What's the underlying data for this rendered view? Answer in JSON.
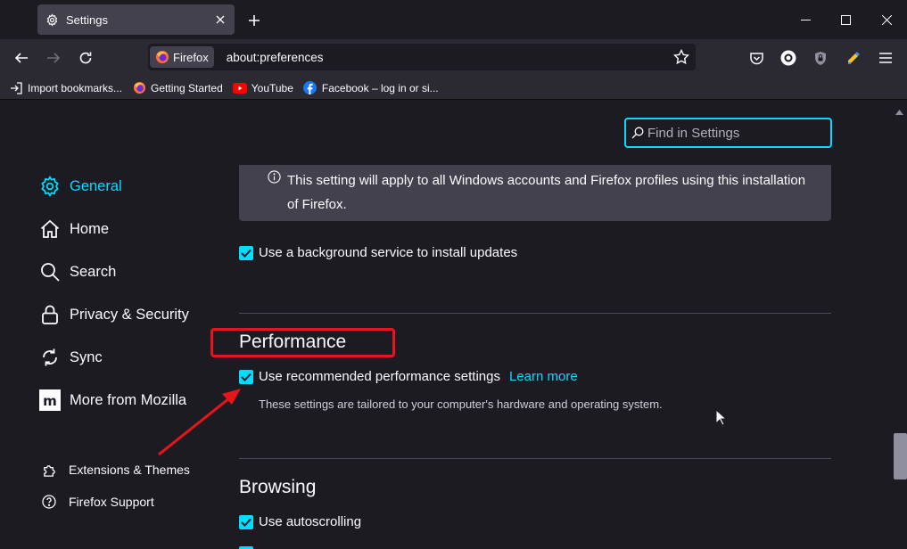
{
  "tab": {
    "title": "Settings"
  },
  "window": {
    "minimize": "minimize",
    "maximize": "maximize",
    "close": "close"
  },
  "urlbar": {
    "identity_label": "Firefox",
    "url": "about:preferences"
  },
  "bookmarks": [
    {
      "label": "Import bookmarks...",
      "icon": "import-icon"
    },
    {
      "label": "Getting Started",
      "icon": "firefox-icon"
    },
    {
      "label": "YouTube",
      "icon": "youtube-icon"
    },
    {
      "label": "Facebook – log in or si...",
      "icon": "facebook-icon"
    }
  ],
  "search": {
    "placeholder": "Find in Settings"
  },
  "sidebar": {
    "items": [
      {
        "label": "General",
        "icon": "gear-icon",
        "selected": true
      },
      {
        "label": "Home",
        "icon": "home-icon"
      },
      {
        "label": "Search",
        "icon": "search-icon"
      },
      {
        "label": "Privacy & Security",
        "icon": "lock-icon"
      },
      {
        "label": "Sync",
        "icon": "sync-icon"
      },
      {
        "label": "More from Mozilla",
        "icon": "mozilla-icon"
      }
    ],
    "footer": [
      {
        "label": "Extensions & Themes",
        "icon": "puzzle-icon"
      },
      {
        "label": "Firefox Support",
        "icon": "help-icon"
      }
    ]
  },
  "main": {
    "info_text": "This setting will apply to all Windows accounts and Firefox profiles using this installation of Firefox.",
    "background_service": {
      "label": "Use a background service to install updates",
      "checked": true
    },
    "performance": {
      "title": "Performance",
      "recommended": {
        "label": "Use recommended performance settings",
        "checked": true
      },
      "learn_more": "Learn more",
      "hint": "These settings are tailored to your computer's hardware and operating system."
    },
    "browsing": {
      "title": "Browsing",
      "autoscroll": {
        "label": "Use autoscrolling",
        "checked": true
      }
    }
  },
  "colors": {
    "accent": "#00ddff",
    "annotation": "#e8141c",
    "background": "#1c1b22",
    "toolbar": "#2b2a33"
  }
}
